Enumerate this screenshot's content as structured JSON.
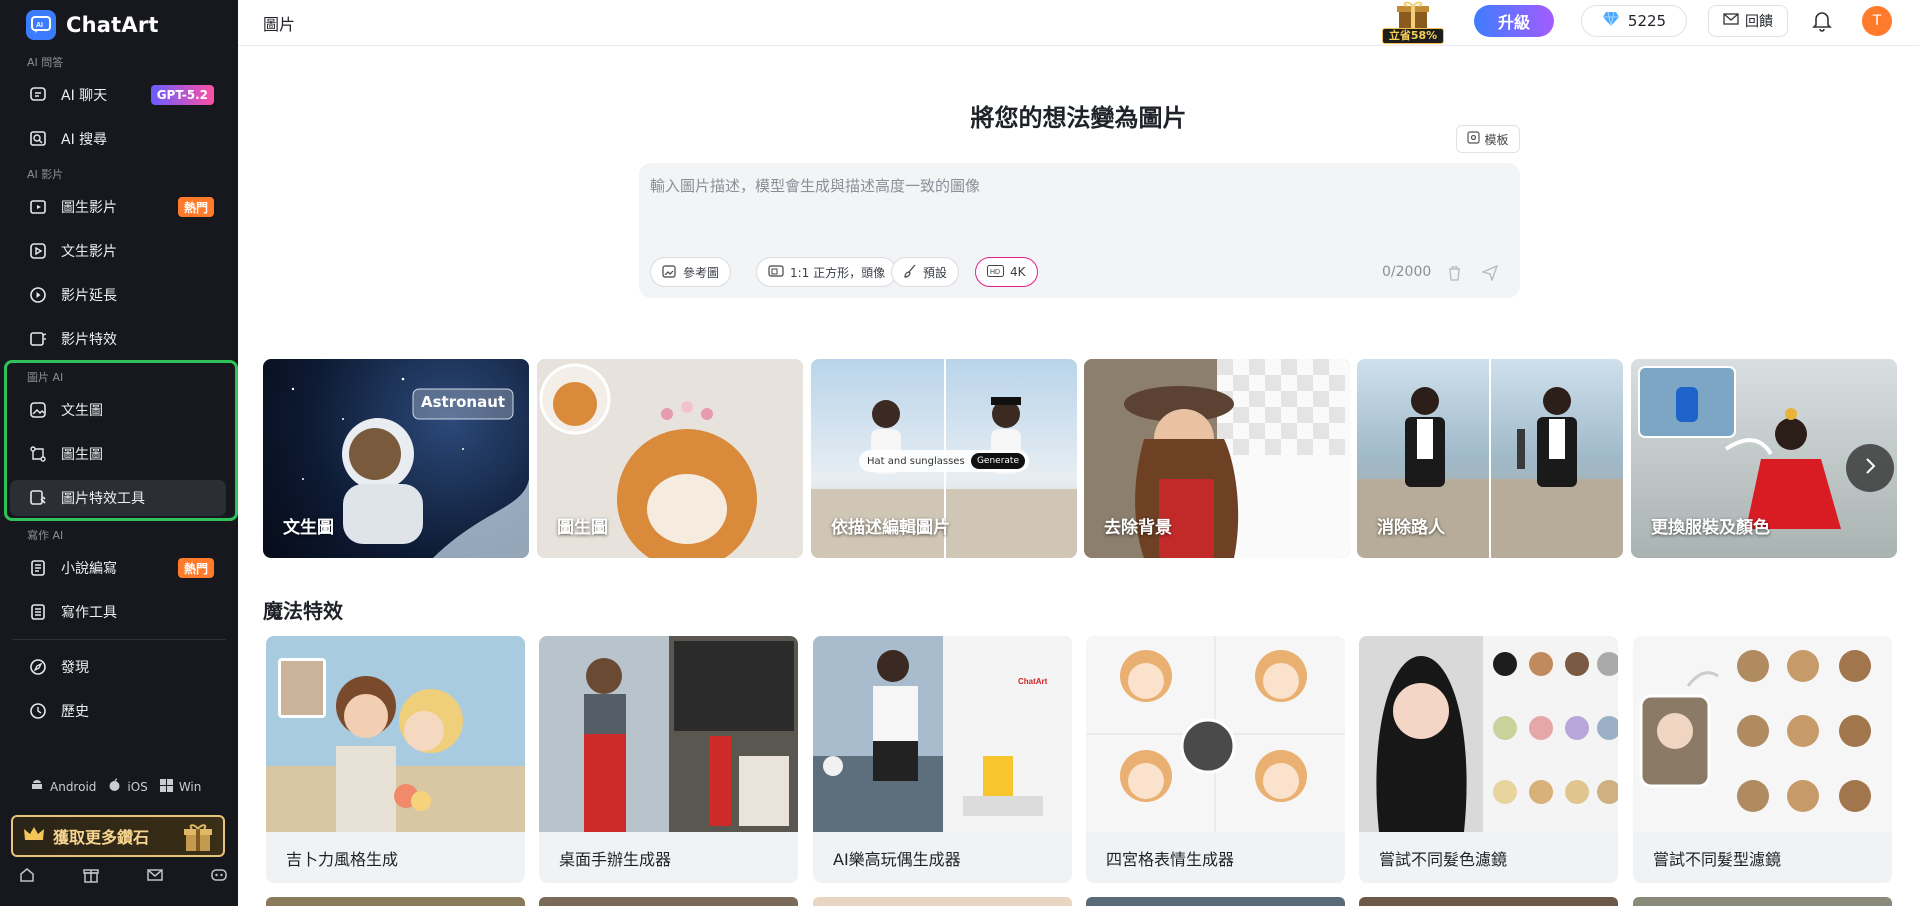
{
  "app": {
    "name": "ChatArt"
  },
  "sidebar": {
    "sections": {
      "ai_qa": "AI 問答",
      "ai_video": "AI 影片",
      "image_ai": "圖片 AI",
      "writing_ai": "寫作 AI"
    },
    "items": [
      {
        "label": "AI 聊天",
        "badge": "GPT-5.2",
        "icon": "chat-icon"
      },
      {
        "label": "AI 搜尋",
        "icon": "search-icon"
      },
      {
        "label": "圖生影片",
        "badge": "熱門",
        "icon": "image-video-icon"
      },
      {
        "label": "文生影片",
        "icon": "text-video-icon"
      },
      {
        "label": "影片延長",
        "icon": "video-extend-icon"
      },
      {
        "label": "影片特效",
        "icon": "video-effect-icon"
      },
      {
        "label": "文生圖",
        "icon": "text-image-icon"
      },
      {
        "label": "圖生圖",
        "icon": "image-image-icon"
      },
      {
        "label": "圖片特效工具",
        "icon": "image-effect-icon"
      },
      {
        "label": "小說編寫",
        "badge": "熱門",
        "icon": "novel-icon"
      },
      {
        "label": "寫作工具",
        "icon": "writing-icon"
      },
      {
        "label": "發現",
        "icon": "compass-icon"
      },
      {
        "label": "歷史",
        "icon": "history-icon"
      }
    ],
    "platforms": [
      "Android",
      "iOS",
      "Win"
    ],
    "promo_label": "獲取更多鑽石"
  },
  "header": {
    "title": "圖片",
    "sale_tag": "立省58%",
    "upgrade_label": "升級",
    "credits": "5225",
    "feedback_label": "回饋",
    "avatar_initial": "T"
  },
  "main": {
    "title": "將您的想法變為圖片",
    "template_label": "模板",
    "prompt_placeholder": "輸入圖片描述，模型會生成與描述高度一致的圖像",
    "chips": {
      "reference": "參考圖",
      "ratio": "1:1 正方形，頭像",
      "preset": "預設",
      "hd": "4K"
    },
    "counter": "0/2000",
    "cards": [
      {
        "label": "文生圖",
        "overlay": "Astronaut"
      },
      {
        "label": "圖生圖"
      },
      {
        "label": "依描述編輯圖片",
        "overlay": "Hat and sunglasses",
        "overlay_button": "Generate"
      },
      {
        "label": "去除背景"
      },
      {
        "label": "消除路人"
      },
      {
        "label": "更換服裝及顏色"
      }
    ],
    "section_title": "魔法特效",
    "magic_items": [
      {
        "label": "吉卜力風格生成"
      },
      {
        "label": "桌面手辦生成器"
      },
      {
        "label": "AI樂高玩偶生成器"
      },
      {
        "label": "四宮格表情生成器"
      },
      {
        "label": "嘗試不同髮色濾鏡"
      },
      {
        "label": "嘗試不同髮型濾鏡"
      }
    ]
  }
}
